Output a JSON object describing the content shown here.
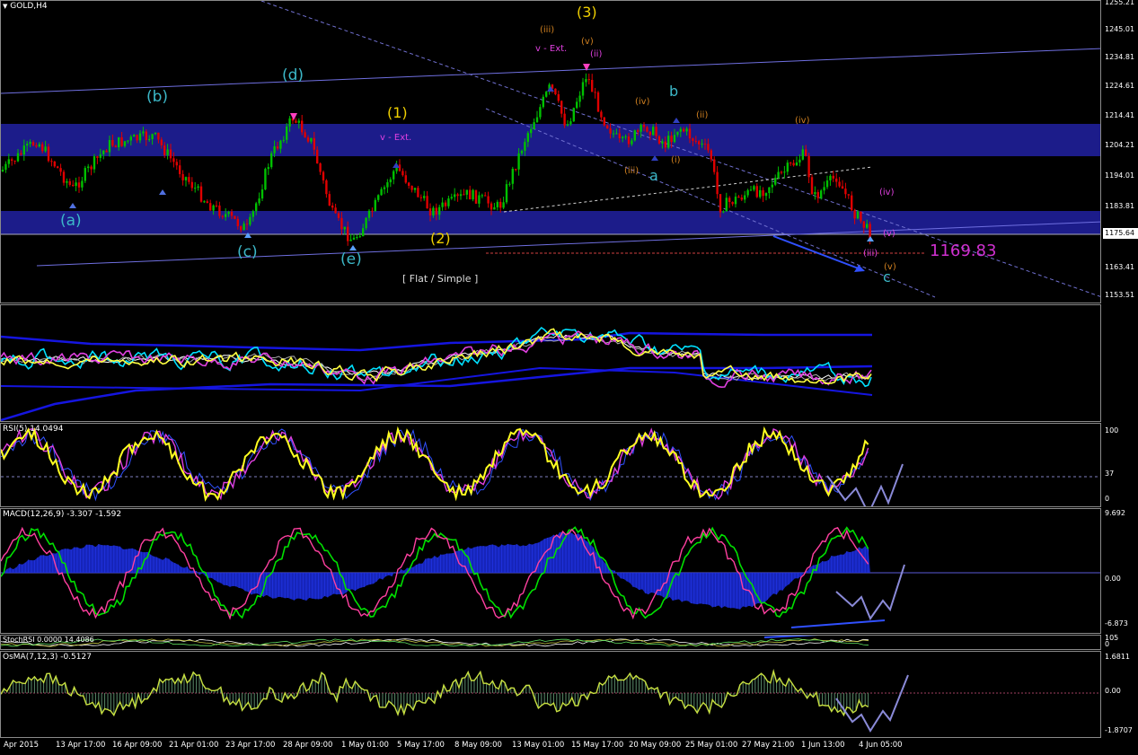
{
  "main": {
    "symbol": "GOLD,H4",
    "price_ticks": [
      "1255.21",
      "1245.01",
      "1234.81",
      "1224.61",
      "1214.41",
      "1204.21",
      "1194.01",
      "1183.81",
      "1173.61",
      "1163.41",
      "1153.51"
    ],
    "current_price": "1175.64",
    "target_price": "1169.83",
    "pattern_note": "[ Flat / Simple ]",
    "colors": {
      "band": "#1c1c8a",
      "bull": "#00c000",
      "bear": "#e00000",
      "channel": "#6f6fe0",
      "cyan": "#3cb8c8",
      "yellow": "#f0d000",
      "orange": "#d08020",
      "magenta": "#e040e0",
      "target": "#d030d0"
    },
    "wave_labels": [
      {
        "text": "(a)",
        "color": "cyan"
      },
      {
        "text": "(b)",
        "color": "cyan"
      },
      {
        "text": "(c)",
        "color": "cyan"
      },
      {
        "text": "(d)",
        "color": "cyan"
      },
      {
        "text": "(e)",
        "color": "cyan"
      },
      {
        "text": "(1)",
        "color": "yellow"
      },
      {
        "text": "(2)",
        "color": "yellow"
      },
      {
        "text": "(3)",
        "color": "yellow"
      },
      {
        "text": "(iii)",
        "color": "orange"
      },
      {
        "text": "(v)",
        "color": "orange"
      },
      {
        "text": "(ii)",
        "color": "magenta"
      },
      {
        "text": "v - Ext.",
        "color": "magenta"
      },
      {
        "text": "v - Ext.",
        "color": "magenta"
      },
      {
        "text": "b",
        "color": "cyan"
      },
      {
        "text": "a",
        "color": "cyan"
      },
      {
        "text": "c",
        "color": "cyan"
      },
      {
        "text": "(iv)",
        "color": "orange"
      },
      {
        "text": "(iii)",
        "color": "orange"
      },
      {
        "text": "(i)",
        "color": "orange"
      },
      {
        "text": "(iv)",
        "color": "orange"
      },
      {
        "text": "(ii)",
        "color": "orange"
      },
      {
        "text": "(iv)",
        "color": "magenta"
      },
      {
        "text": "(iii)",
        "color": "magenta"
      },
      {
        "text": "(v)",
        "color": "magenta"
      },
      {
        "text": "(v)",
        "color": "orange"
      }
    ]
  },
  "ma_panel": {
    "label": ""
  },
  "rsi": {
    "label": "RSI(5) 14.0494",
    "ticks": [
      "100",
      "37",
      "0"
    ]
  },
  "macd": {
    "label": "MACD(12,26,9) -3.307 -1.592",
    "ticks": [
      "9.692",
      "0.00",
      "-6.873"
    ]
  },
  "stoch": {
    "label": "StochRSI 0.0000 14.4086",
    "ticks": [
      "105",
      "0"
    ]
  },
  "osma": {
    "label": "OsMA(7,12,3) -0.5127",
    "ticks": [
      "1.6811",
      "0.00",
      "-1.8707"
    ]
  },
  "time_axis": [
    "Apr 2015",
    "13 Apr 17:00",
    "16 Apr 09:00",
    "21 Apr 01:00",
    "23 Apr 17:00",
    "28 Apr 09:00",
    "1 May 01:00",
    "5 May 17:00",
    "8 May 09:00",
    "13 May 01:00",
    "15 May 17:00",
    "20 May 09:00",
    "25 May 01:00",
    "27 May 21:00",
    "1 Jun 13:00",
    "4 Jun 05:00"
  ]
}
